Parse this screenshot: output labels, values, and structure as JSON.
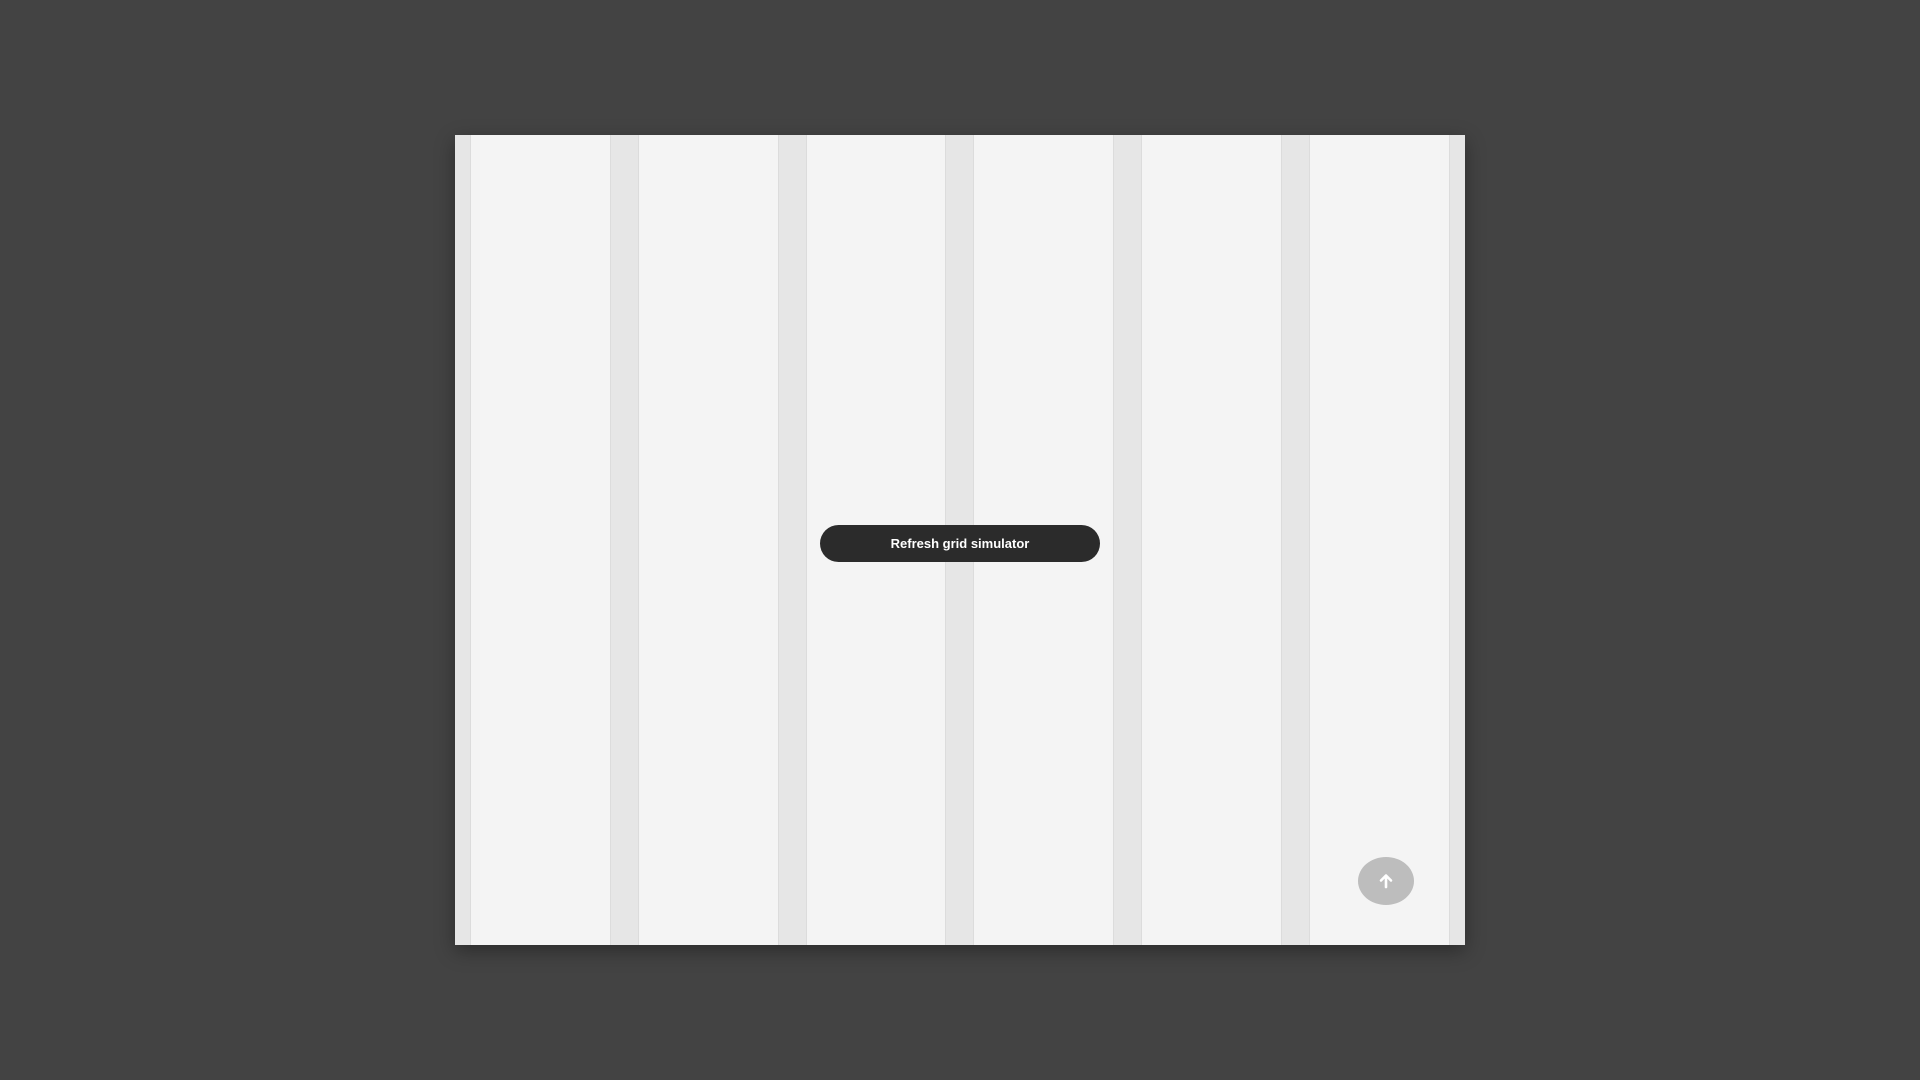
{
  "page": {
    "background_color": "#434343"
  },
  "simulator": {
    "column_color": "#f4f4f4",
    "gutter_color": "#e6e6e6",
    "refresh_label": "Refresh grid simulator",
    "refresh_button_color": "#2b2b2b",
    "scroll_top_icon": "arrow-up-icon",
    "scroll_top_button_color": "#bdbdbd"
  }
}
